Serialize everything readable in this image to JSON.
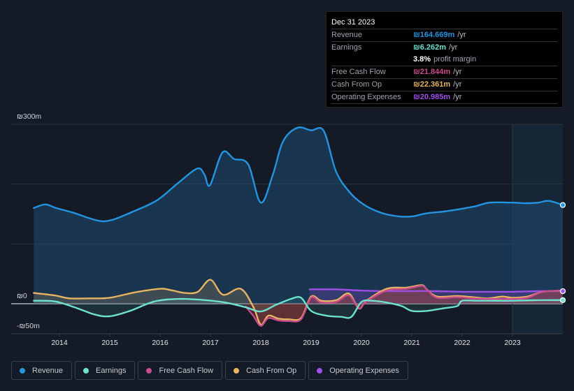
{
  "tooltip": {
    "date": "Dec 31 2023",
    "rows": [
      {
        "label": "Revenue",
        "value": "₪164.669m",
        "unit": "/yr",
        "color": "#2394df"
      },
      {
        "label": "Earnings",
        "value": "₪6.262m",
        "unit": "/yr",
        "color": "#6de2cf"
      },
      {
        "label": "",
        "margin_value": "3.8%",
        "margin_label": "profit margin"
      },
      {
        "label": "Free Cash Flow",
        "value": "₪21.844m",
        "unit": "/yr",
        "color": "#c84b8c"
      },
      {
        "label": "Cash From Op",
        "value": "₪22.361m",
        "unit": "/yr",
        "color": "#e9b461"
      },
      {
        "label": "Operating Expenses",
        "value": "₪20.985m",
        "unit": "/yr",
        "color": "#9d4fe6"
      }
    ]
  },
  "legend": [
    {
      "label": "Revenue",
      "color": "#2394df"
    },
    {
      "label": "Earnings",
      "color": "#6de2cf"
    },
    {
      "label": "Free Cash Flow",
      "color": "#c84b8c"
    },
    {
      "label": "Cash From Op",
      "color": "#e9b461"
    },
    {
      "label": "Operating Expenses",
      "color": "#9d4fe6"
    }
  ],
  "chart_data": {
    "type": "area",
    "title": "",
    "xlabel": "",
    "ylabel": "",
    "y_tick_labels": [
      "₪300m",
      "₪0",
      "-₪50m"
    ],
    "x_tick_labels": [
      "2014",
      "2015",
      "2016",
      "2017",
      "2018",
      "2019",
      "2020",
      "2021",
      "2022",
      "2023"
    ],
    "x_ticks": [
      2014,
      2015,
      2016,
      2017,
      2018,
      2019,
      2020,
      2021,
      2022,
      2023
    ],
    "xlim": [
      2013.5,
      2024.0
    ],
    "ylim": [
      -50,
      300
    ],
    "gridlines_y": [
      300,
      200,
      100,
      0
    ],
    "highlight_from": 2023.0,
    "legend_position": "bottom-left",
    "series": [
      {
        "name": "Revenue",
        "color": "#2394df",
        "x": [
          2013.49,
          2013.72,
          2013.93,
          2014.28,
          2014.76,
          2015.04,
          2015.46,
          2015.94,
          2016.36,
          2016.74,
          2016.88,
          2016.99,
          2017.24,
          2017.47,
          2017.75,
          2018.0,
          2018.24,
          2018.44,
          2018.72,
          2019.0,
          2019.25,
          2019.49,
          2019.76,
          2020.04,
          2020.39,
          2020.74,
          2021.01,
          2021.29,
          2021.71,
          2022.26,
          2022.54,
          2023.0,
          2023.24,
          2023.51,
          2023.72,
          2024.0
        ],
        "values": [
          160,
          166,
          160,
          152,
          139,
          140,
          154,
          173,
          202,
          226,
          216,
          198,
          253,
          242,
          233,
          169,
          216,
          271,
          294,
          290,
          289,
          222,
          187,
          166,
          152,
          146,
          146,
          151,
          155,
          163,
          169,
          169,
          168,
          169,
          172,
          165
        ]
      },
      {
        "name": "Earnings",
        "color": "#6de2cf",
        "x": [
          2013.49,
          2013.9,
          2014.3,
          2014.7,
          2015.0,
          2015.4,
          2015.9,
          2016.4,
          2016.9,
          2017.3,
          2017.7,
          2018.0,
          2018.3,
          2018.6,
          2018.8,
          2019.0,
          2019.3,
          2019.6,
          2019.8,
          2020.0,
          2020.2,
          2020.5,
          2020.8,
          2021.0,
          2021.3,
          2021.6,
          2021.9,
          2022.0,
          2022.3,
          2022.6,
          2023.0,
          2023.5,
          2024.0
        ],
        "values": [
          5,
          4,
          -6,
          -18,
          -21,
          -12,
          4,
          8,
          6,
          2,
          -6,
          -13,
          -2,
          8,
          10,
          -12,
          -20,
          -22,
          -22,
          3,
          5,
          2,
          -4,
          -12,
          -12,
          -8,
          -4,
          5,
          5,
          5,
          5,
          6,
          6
        ]
      },
      {
        "name": "Free Cash Flow",
        "color": "#c84b8c",
        "x": [
          2017.7,
          2017.85,
          2018.0,
          2018.15,
          2018.35,
          2018.55,
          2018.8,
          2019.0,
          2019.2,
          2019.5,
          2019.75,
          2019.95,
          2020.1,
          2020.5,
          2020.9,
          2021.2,
          2021.3,
          2021.5,
          2021.9,
          2022.2,
          2022.5,
          2022.8,
          2023.0,
          2023.3,
          2023.6,
          2024.0
        ],
        "values": [
          -5,
          -20,
          -37,
          -24,
          -28,
          -29,
          -26,
          10,
          2,
          3,
          14,
          -8,
          4,
          22,
          25,
          30,
          24,
          10,
          11,
          9,
          8,
          8,
          8,
          10,
          20,
          22
        ]
      },
      {
        "name": "Cash From Op",
        "color": "#e9b461",
        "x": [
          2013.49,
          2013.9,
          2014.2,
          2014.6,
          2015.0,
          2015.5,
          2016.0,
          2016.2,
          2016.5,
          2016.75,
          2017.0,
          2017.25,
          2017.6,
          2017.85,
          2018.0,
          2018.15,
          2018.35,
          2018.55,
          2018.8,
          2019.0,
          2019.2,
          2019.5,
          2019.75,
          2019.95,
          2020.1,
          2020.5,
          2020.9,
          2021.2,
          2021.3,
          2021.5,
          2021.9,
          2022.2,
          2022.5,
          2022.8,
          2023.0,
          2023.3,
          2023.6,
          2024.0
        ],
        "values": [
          18,
          14,
          9,
          9,
          10,
          19,
          25,
          23,
          18,
          20,
          40,
          15,
          25,
          -5,
          -35,
          -20,
          -25,
          -26,
          -24,
          12,
          5,
          6,
          17,
          -8,
          5,
          25,
          27,
          31,
          24,
          12,
          13,
          11,
          9,
          12,
          10,
          12,
          20,
          22
        ]
      },
      {
        "name": "Operating Expenses",
        "color": "#9d4fe6",
        "x": [
          2018.97,
          2019.5,
          2020.0,
          2020.5,
          2021.0,
          2021.5,
          2022.0,
          2022.5,
          2023.0,
          2023.5,
          2024.0
        ],
        "values": [
          24,
          24,
          22,
          21,
          21,
          21,
          20,
          20,
          20,
          21,
          21
        ]
      }
    ]
  }
}
